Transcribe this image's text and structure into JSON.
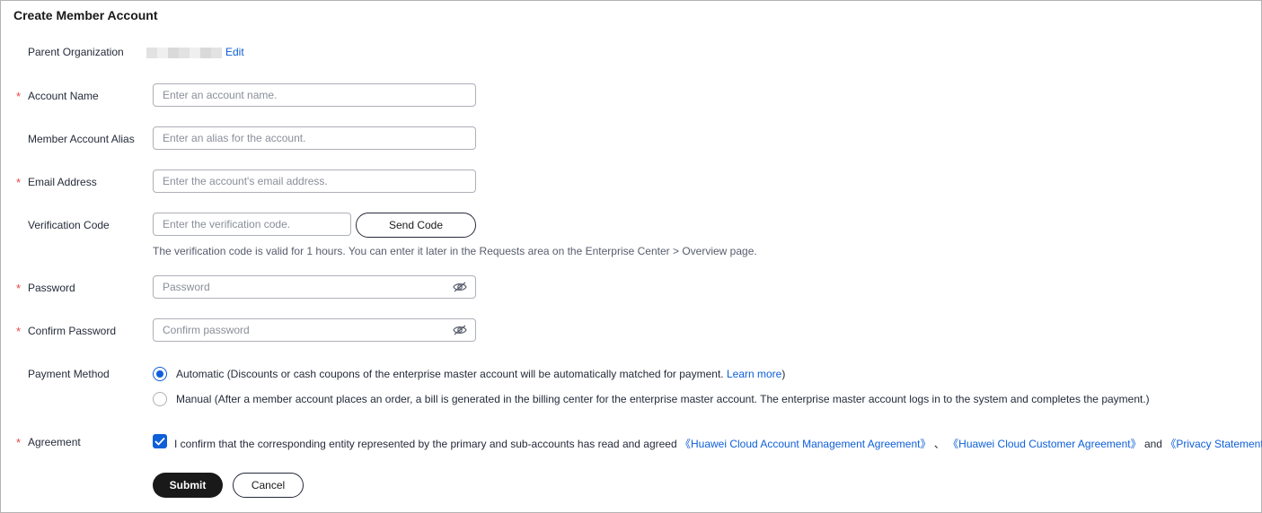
{
  "page": {
    "title": "Create Member Account"
  },
  "parent_org": {
    "label": "Parent Organization",
    "edit_label": "Edit"
  },
  "account_name": {
    "label": "Account Name",
    "placeholder": "Enter an account name."
  },
  "alias": {
    "label": "Member Account Alias",
    "placeholder": "Enter an alias for the account."
  },
  "email": {
    "label": "Email Address",
    "placeholder": "Enter the account's email address."
  },
  "verification": {
    "label": "Verification Code",
    "placeholder": "Enter the verification code.",
    "send_label": "Send Code",
    "hint": "The verification code is valid for 1 hours. You can enter it later in the Requests area on the Enterprise Center > Overview page."
  },
  "password": {
    "label": "Password",
    "placeholder": "Password",
    "icon": "eye-hidden-icon"
  },
  "confirm_password": {
    "label": "Confirm Password",
    "placeholder": "Confirm password",
    "icon": "eye-hidden-icon"
  },
  "payment": {
    "label": "Payment Method",
    "automatic_text": "Automatic (Discounts or cash coupons of the enterprise master account will be automatically matched for payment. ",
    "learn_more": "Learn more",
    "automatic_close": ")",
    "manual_text": "Manual (After a member account places an order, a bill is generated in the billing center for the enterprise master account. The enterprise master account logs in to the system and completes the payment.)",
    "selected": "automatic"
  },
  "agreement": {
    "label": "Agreement",
    "checked": true,
    "text_prefix": "I confirm that the corresponding entity represented by the primary and sub-accounts has read and agreed ",
    "link1": "《Huawei Cloud Account Management Agreement》",
    "sep": " 、 ",
    "link2": "《Huawei Cloud Customer Agreement》",
    "and_text": " and ",
    "link3": "《Privacy Statement》"
  },
  "actions": {
    "submit_label": "Submit",
    "cancel_label": "Cancel"
  },
  "required_mark": "*",
  "colors": {
    "accent": "#0e5fd8",
    "required": "#e54545",
    "primary_button": "#191919"
  }
}
